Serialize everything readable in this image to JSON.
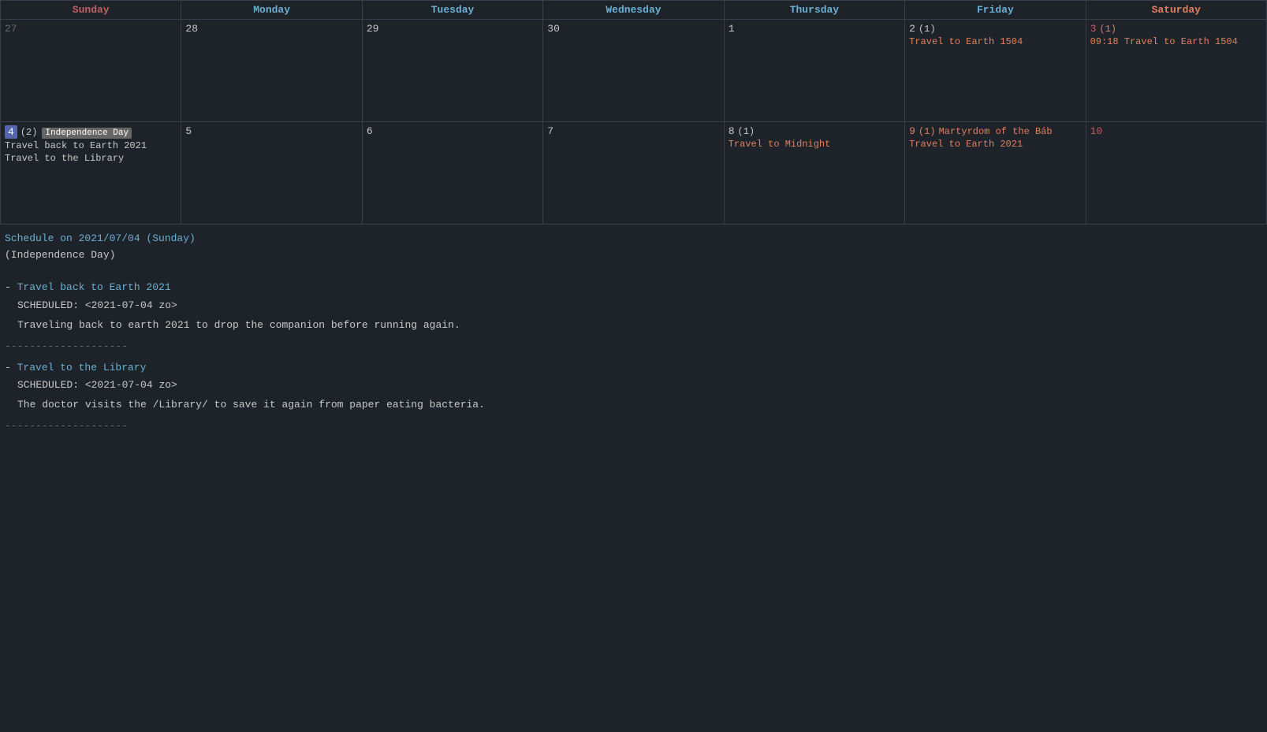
{
  "calendar": {
    "headers": [
      {
        "label": "Sunday",
        "class": "sunday"
      },
      {
        "label": "Monday",
        "class": "monday"
      },
      {
        "label": "Tuesday",
        "class": "tuesday"
      },
      {
        "label": "Wednesday",
        "class": "wednesday"
      },
      {
        "label": "Thursday",
        "class": "thursday"
      },
      {
        "label": "Friday",
        "class": "friday"
      },
      {
        "label": "Saturday",
        "class": "saturday"
      }
    ],
    "weeks": [
      [
        {
          "day": "27",
          "style": "grayed",
          "events": []
        },
        {
          "day": "28",
          "style": "normal",
          "events": []
        },
        {
          "day": "29",
          "style": "normal",
          "events": []
        },
        {
          "day": "30",
          "style": "normal",
          "events": []
        },
        {
          "day": "1",
          "style": "normal",
          "events": []
        },
        {
          "day": "2",
          "style": "normal",
          "count": "(1)",
          "events": [
            {
              "label": "Travel to Earth 1504",
              "color": "orange"
            }
          ]
        },
        {
          "day": "3",
          "style": "red",
          "count": "(1)",
          "events": [
            {
              "label": "09:18 Travel to Earth 1504",
              "color": "orange"
            }
          ]
        }
      ],
      [
        {
          "day": "4",
          "style": "highlighted",
          "badge": "Independence Day",
          "count": "(2)",
          "events": [
            {
              "label": "Travel back to Earth 2021",
              "color": "gray"
            },
            {
              "label": "Travel to the Library",
              "color": "gray"
            }
          ]
        },
        {
          "day": "5",
          "style": "normal",
          "events": []
        },
        {
          "day": "6",
          "style": "normal",
          "events": []
        },
        {
          "day": "7",
          "style": "normal",
          "events": []
        },
        {
          "day": "8",
          "style": "normal",
          "count": "(1)",
          "events": [
            {
              "label": "Travel to Midnight",
              "color": "orange"
            }
          ]
        },
        {
          "day": "9",
          "style": "orange",
          "count": "(1)",
          "badge2": "Martyrdom of the Báb",
          "events": [
            {
              "label": "Travel to Earth 2021",
              "color": "orange"
            }
          ]
        },
        {
          "day": "10",
          "style": "red",
          "events": []
        }
      ]
    ]
  },
  "schedule": {
    "title": "Schedule on 2021/07/04 (Sunday)",
    "subtitle": "(Independence Day)",
    "items": [
      {
        "prefix": "- ",
        "title": "Travel back to Earth 2021",
        "scheduled_label": "SCHEDULED:",
        "scheduled_value": "<2021-07-04 zo>",
        "description": "Traveling back to earth 2021 to drop the companion before running again."
      },
      {
        "prefix": "- ",
        "title": "Travel to the Library",
        "scheduled_label": "SCHEDULED:",
        "scheduled_value": "<2021-07-04 zo>",
        "description": "The doctor visits the /Library/ to save it again from paper eating bacteria."
      }
    ],
    "divider": "--------------------"
  }
}
